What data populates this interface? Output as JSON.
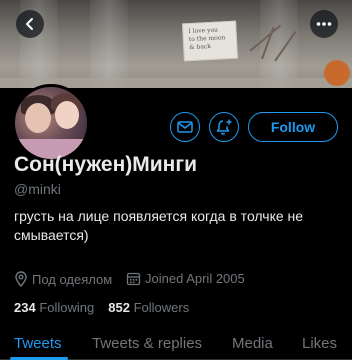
{
  "header": {
    "back_icon": "arrow-left-icon",
    "more_icon": "more-horizontal-icon",
    "banner_note": [
      "I love you",
      "to the moon",
      "& back"
    ]
  },
  "profile": {
    "display_name": "Сон(нужен)Минги",
    "handle": "@minki",
    "bio": "грусть на лице появляется когда в толчке не смывается)",
    "location": "Под одеялом",
    "joined": "Joined April 2005",
    "following_count": "234",
    "following_label": "Following",
    "followers_count": "852",
    "followers_label": "Followers"
  },
  "actions": {
    "message_icon": "mail-icon",
    "notify_icon": "bell-plus-icon",
    "follow_label": "Follow"
  },
  "tabs": [
    {
      "label": "Tweets",
      "active": true
    },
    {
      "label": "Tweets & replies",
      "active": false
    },
    {
      "label": "Media",
      "active": false
    },
    {
      "label": "Likes",
      "active": false
    }
  ],
  "colors": {
    "accent": "#1d9bf0",
    "background": "#000000",
    "secondary_text": "#71767b"
  }
}
